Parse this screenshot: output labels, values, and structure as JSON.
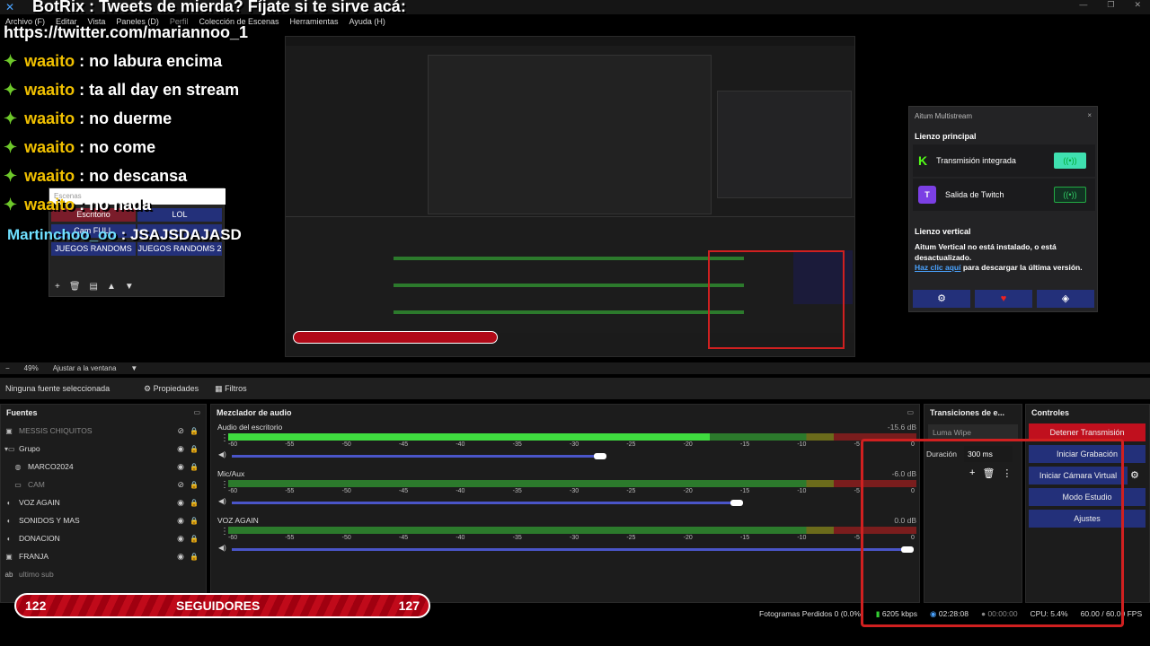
{
  "app": {
    "title": "BotRix : Tweets de mierda? Fíjate si te sirve acá:"
  },
  "menu": [
    "Archivo (F)",
    "Editar",
    "Vista",
    "Paneles (D)",
    "Perfil",
    "Colección de Escenas",
    "Herramientas",
    "Ayuda (H)"
  ],
  "overlay": {
    "url": "https://twitter.com/mariannoo_1",
    "chat": [
      {
        "user": "waaito",
        "msg": " : no labura encima"
      },
      {
        "user": "waaito",
        "msg": " : ta all day en stream"
      },
      {
        "user": "waaito",
        "msg": " : no duerme"
      },
      {
        "user": "waaito",
        "msg": " : no come"
      },
      {
        "user": "waaito",
        "msg": " : no descansa"
      },
      {
        "user": "waaito",
        "msg": " : no nada"
      }
    ],
    "last_chat": {
      "user": "Martinchoo_oo",
      "msg": " : JSAJSDAJASD"
    }
  },
  "scenes": {
    "header": "Escenas",
    "items": [
      "Escritorio",
      "LOL",
      "Cam FULL",
      "",
      "JUEGOS RANDOMS",
      "JUEGOS RANDOMS 2"
    ]
  },
  "multistream": {
    "title": "Aitum Multistream",
    "main_canvas": "Lienzo principal",
    "outputs": [
      {
        "name": "Transmisión integrada",
        "brand": "K"
      },
      {
        "name": "Salida de Twitch",
        "brand": "T"
      }
    ],
    "vertical_title": "Lienzo vertical",
    "vertical_msg": "Aitum Vertical no está instalado, o está desactualizado.",
    "link": "Haz clic aquí",
    "link_rest": " para descargar la última versión."
  },
  "zoom": {
    "value": "49%",
    "fit": "Ajustar a la ventana"
  },
  "source_bar": {
    "none": "Ninguna fuente seleccionada",
    "props": "Propiedades",
    "filters": "Filtros"
  },
  "sources": {
    "title": "Fuentes",
    "items": [
      {
        "name": "MESSIS CHIQUITOS",
        "dim": true
      },
      {
        "name": "Grupo",
        "dim": false
      },
      {
        "name": "MARCO2024",
        "dim": false
      },
      {
        "name": "CAM",
        "dim": true
      },
      {
        "name": "VOZ AGAIN",
        "dim": false
      },
      {
        "name": "SONIDOS Y MAS",
        "dim": false
      },
      {
        "name": "DONACION",
        "dim": false
      },
      {
        "name": "FRANJA",
        "dim": false
      },
      {
        "name": "ultimo sub",
        "dim": true
      }
    ]
  },
  "mixer": {
    "title": "Mezclador de audio",
    "ticks": [
      "-60",
      "-55",
      "-50",
      "-45",
      "-40",
      "-35",
      "-30",
      "-25",
      "-20",
      "-15",
      "-10",
      "-5",
      "0"
    ],
    "channels": [
      {
        "name": "Audio del escritorio",
        "db": "-15.6 dB",
        "level": 0.7,
        "vol": 0.54
      },
      {
        "name": "Mic/Aux",
        "db": "-6.0 dB",
        "level": 0,
        "vol": 0.74
      },
      {
        "name": "VOZ AGAIN",
        "db": "0.0 dB",
        "level": 0,
        "vol": 0.99
      }
    ]
  },
  "transitions": {
    "title": "Transiciones de e...",
    "selected": "Luma Wipe",
    "duration_label": "Duración",
    "duration": "300 ms"
  },
  "controls": {
    "title": "Controles",
    "buttons": [
      "Detener Transmisión",
      "Iniciar Grabación",
      "Iniciar Cámara Virtual",
      "Modo Estudio",
      "Ajustes"
    ]
  },
  "followers": {
    "left": "122",
    "label": "SEGUIDORES",
    "right": "127"
  },
  "status": {
    "dropped": "Fotogramas Perdidos 0 (0.0%)",
    "kbps": "6205 kbps",
    "live_time": "02:28:08",
    "rec_time": "00:00:00",
    "cpu": "CPU: 5.4%",
    "fps": "60.00 / 60.00 FPS"
  },
  "colors": {
    "accent": "#23307a",
    "stop": "#c0101e",
    "chat_user": "#f0c000",
    "chat_user2": "#6fe0ff",
    "green": "#6ec82a"
  }
}
